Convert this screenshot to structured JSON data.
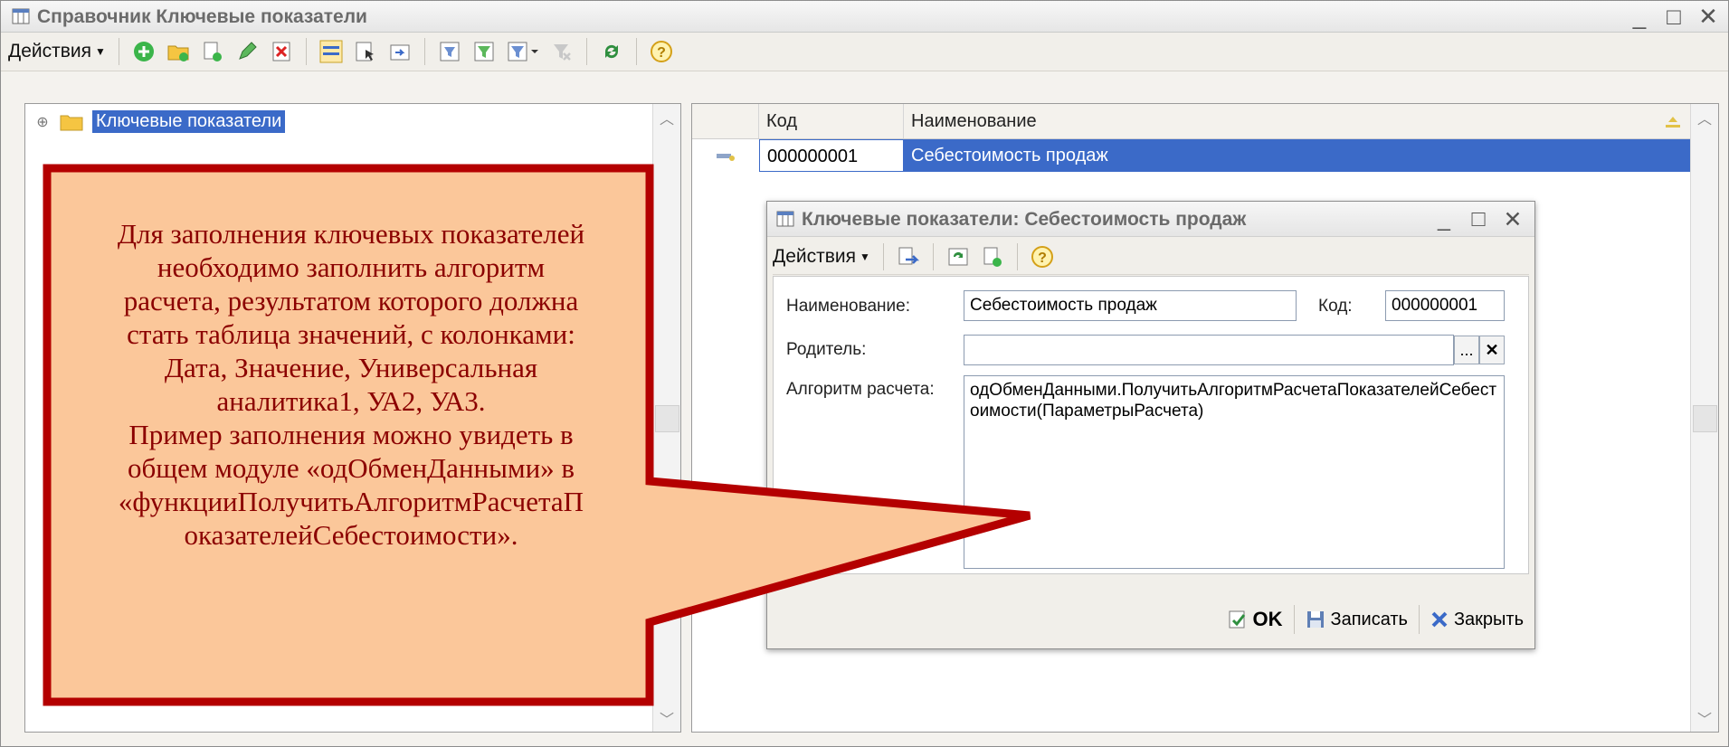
{
  "window": {
    "title": "Справочник Ключевые показатели",
    "controls": [
      "_",
      "□",
      "✕"
    ]
  },
  "toolbar": {
    "actions_label": "Действия"
  },
  "tree": {
    "root_label": "Ключевые показатели",
    "expander": "⊕"
  },
  "grid": {
    "columns": [
      "Код",
      "Наименование"
    ],
    "rows": [
      {
        "code": "000000001",
        "name": "Себестоимость продаж"
      }
    ]
  },
  "dialog": {
    "title": "Ключевые показатели: Себестоимость продаж",
    "actions_label": "Действия",
    "name_label": "Наименование:",
    "name_value": "Себестоимость продаж",
    "code_label": "Код:",
    "code_value": "000000001",
    "parent_label": "Родитель:",
    "parent_value": "",
    "parent_select": "...",
    "parent_clear": "✕",
    "algo_label": "Алгоритм расчета:",
    "algo_value": "одОбменДанными.ПолучитьАлгоритмРасчетаПоказателейСебестоимости(ПараметрыРасчета)",
    "ok_label": "OK",
    "save_label": "Записать",
    "close_label": "Закрыть"
  },
  "callout": {
    "lines": [
      "Для заполнения ключевых показателей",
      "необходимо заполнить алгоритм",
      "расчета, результатом которого должна",
      "стать таблица значений, с колонками:",
      "Дата, Значение, Универсальная",
      "аналитика1, УА2, УА3.",
      "Пример заполнения можно увидеть в",
      "общем модуле «одОбменДанными» в",
      "«функцииПолучитьАлгоритмРасчетаП",
      "оказателейСебестоимости»."
    ],
    "fill_color": "#fbc79a",
    "border_color": "#b40000",
    "text_color": "#8b0000"
  },
  "colors": {
    "selection": "#3b6ac8",
    "window_bg": "#f4f2ee"
  }
}
